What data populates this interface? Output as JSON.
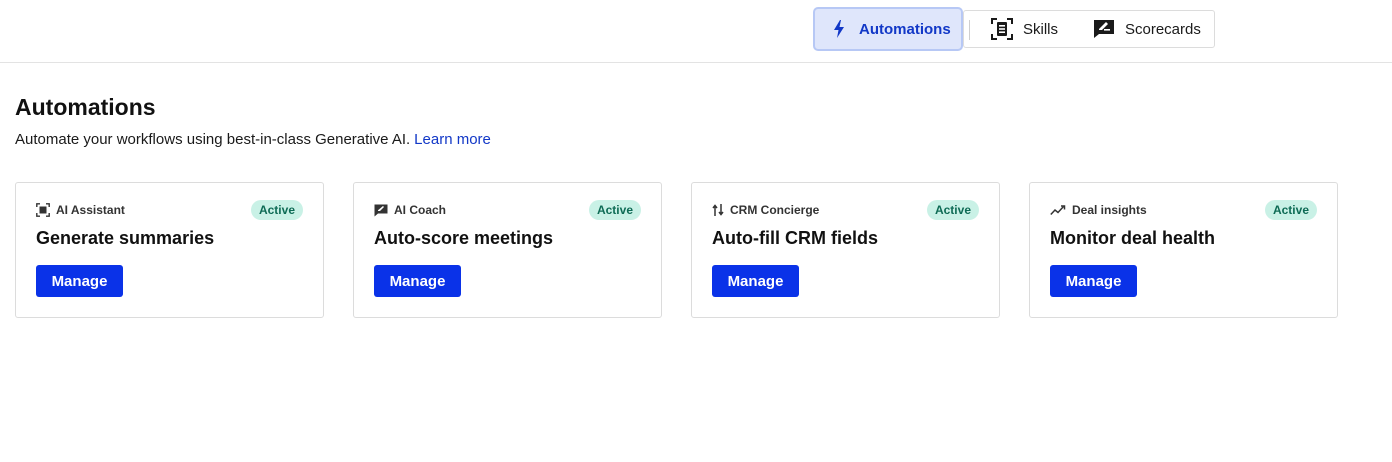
{
  "tabs": {
    "automations": "Automations",
    "skills": "Skills",
    "scorecards": "Scorecards"
  },
  "page": {
    "title": "Automations",
    "subtitle": "Automate your workflows using best-in-class Generative AI.",
    "learn_more": "Learn more"
  },
  "cards": [
    {
      "category": "AI Assistant",
      "status": "Active",
      "title": "Generate summaries",
      "button": "Manage",
      "icon": "ai-assistant-icon"
    },
    {
      "category": "AI Coach",
      "status": "Active",
      "title": "Auto-score meetings",
      "button": "Manage",
      "icon": "ai-coach-icon"
    },
    {
      "category": "CRM Concierge",
      "status": "Active",
      "title": "Auto-fill CRM fields",
      "button": "Manage",
      "icon": "crm-concierge-icon"
    },
    {
      "category": "Deal insights",
      "status": "Active",
      "title": "Monitor deal health",
      "button": "Manage",
      "icon": "deal-insights-icon"
    }
  ],
  "colors": {
    "accent": "#0a32e8",
    "link": "#1238c7",
    "badge_bg": "#c9f1e6",
    "badge_text": "#0e6b55",
    "active_tab_bg": "#dfe6fb"
  }
}
